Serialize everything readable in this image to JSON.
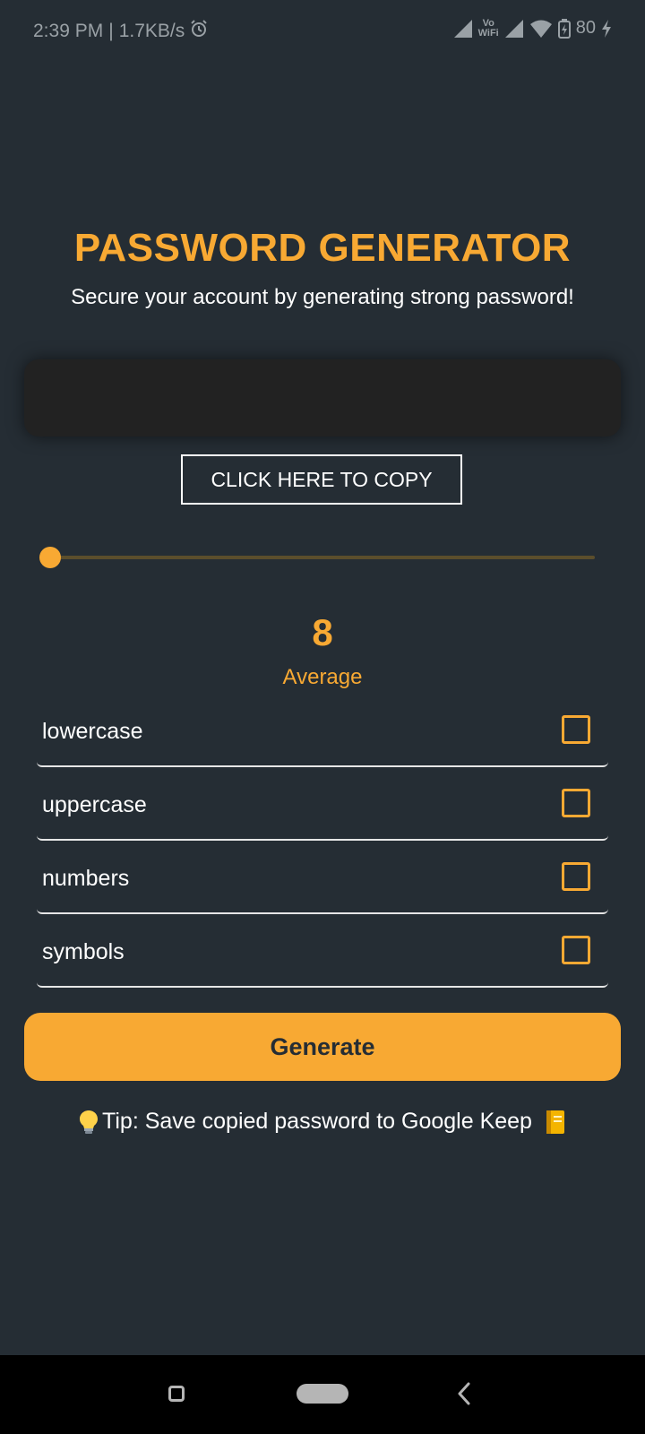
{
  "status_bar": {
    "time": "2:39 PM",
    "separator": "|",
    "net_speed": "1.7KB/s",
    "vowifi_top": "Vo",
    "vowifi_bottom": "WiFi",
    "battery": "80"
  },
  "header": {
    "title": "PASSWORD GENERATOR",
    "subtitle": "Secure your account by generating strong password!"
  },
  "password": {
    "value": ""
  },
  "copy_button": {
    "label": "CLICK HERE TO COPY"
  },
  "slider": {
    "level_fraction": 0
  },
  "length": {
    "value": "8",
    "strength": "Average"
  },
  "options": [
    {
      "label": "lowercase",
      "checked": false
    },
    {
      "label": "uppercase",
      "checked": false
    },
    {
      "label": "numbers",
      "checked": false
    },
    {
      "label": "symbols",
      "checked": false
    }
  ],
  "generate_button": {
    "label": "Generate"
  },
  "tip": {
    "text": "Tip: Save copied password to Google Keep"
  },
  "colors": {
    "background": "#252d34",
    "accent": "#f8a933",
    "display_bg": "#222222"
  },
  "icons": {
    "status_left": [
      "alarm-icon"
    ],
    "status_right": [
      "signal-icon",
      "vowifi-icon",
      "signal-icon",
      "wifi-icon",
      "battery-icon",
      "charging-icon"
    ],
    "tip": [
      "lightbulb-icon",
      "notebook-icon"
    ],
    "nav": [
      "recents-icon",
      "home-icon",
      "back-icon"
    ]
  }
}
